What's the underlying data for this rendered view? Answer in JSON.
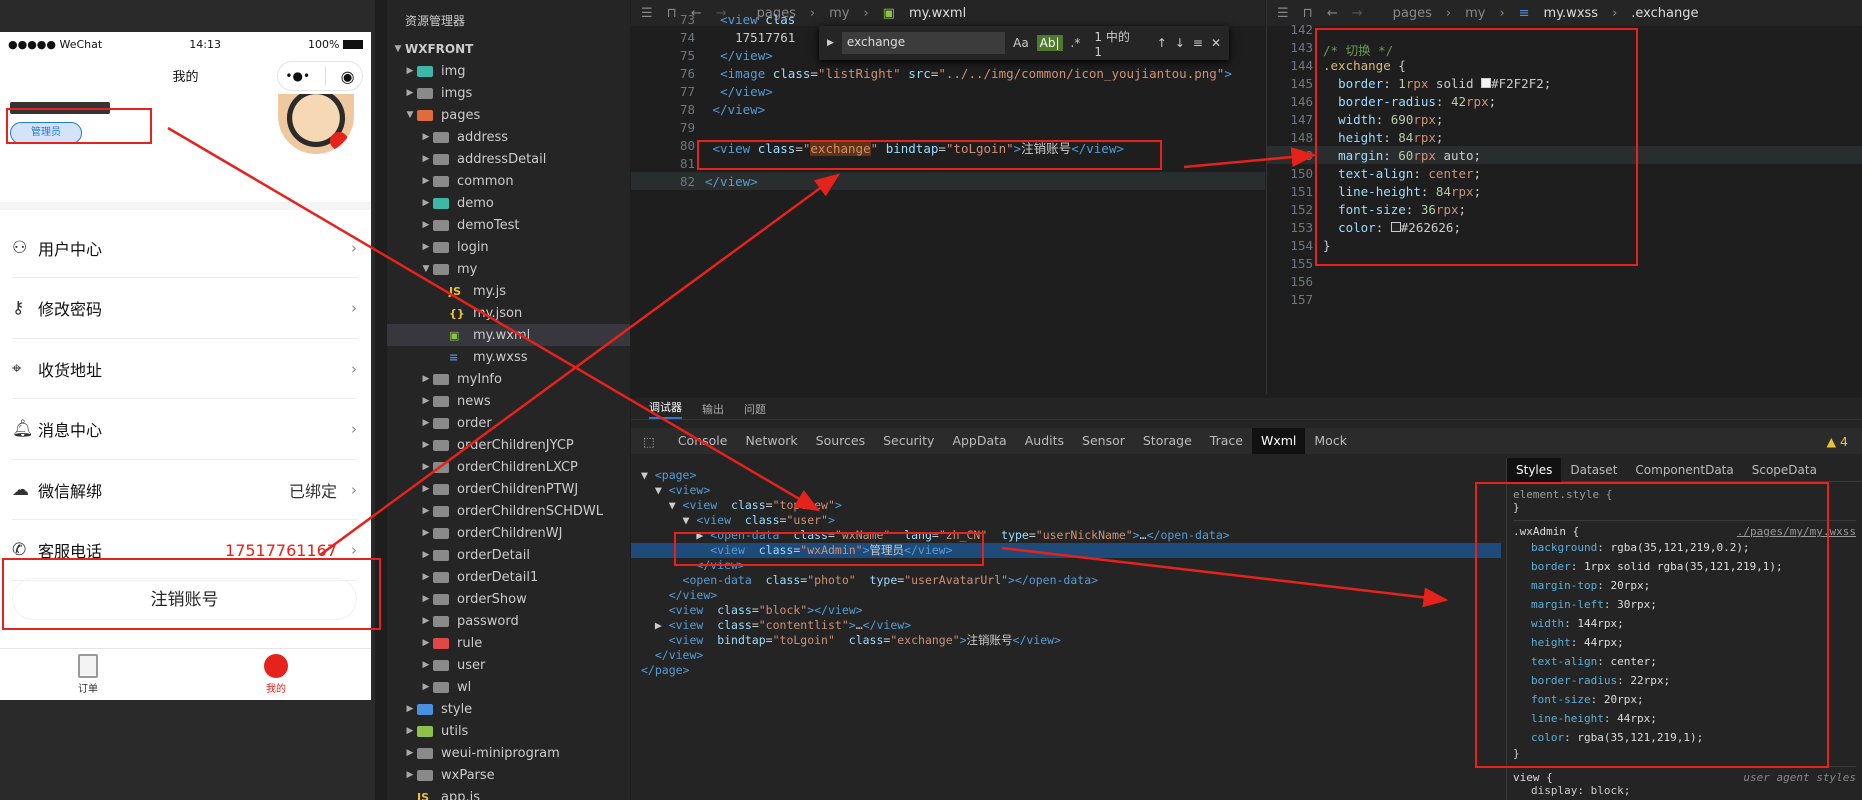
{
  "phone": {
    "status": {
      "carrier": "●●●●● WeChat",
      "time": "14:13",
      "battery": "100%"
    },
    "title": "我的",
    "capsule": {
      "more": "•●•",
      "close": "◉"
    },
    "admin_badge": "管理员",
    "menu": [
      {
        "icon": "user-icon",
        "label": "用户中心",
        "value": ""
      },
      {
        "icon": "key-icon",
        "label": "修改密码",
        "value": ""
      },
      {
        "icon": "location-pin-icon",
        "label": "收货地址",
        "value": ""
      },
      {
        "icon": "bell-icon",
        "label": "消息中心",
        "value": ""
      },
      {
        "icon": "wechat-icon",
        "label": "微信解绑",
        "value": "已绑定"
      },
      {
        "icon": "phone-icon",
        "label": "客服电话",
        "value": "17517761167"
      }
    ],
    "logout": "注销账号",
    "tabs": [
      {
        "label": "订单"
      },
      {
        "label": "我的"
      }
    ],
    "accent": "#e5221c"
  },
  "explorer": {
    "header": "资源管理器",
    "root": "WXFRONT",
    "items": [
      {
        "label": "img",
        "type": "folder",
        "color": "#3fb6a8",
        "exp": false
      },
      {
        "label": "imgs",
        "type": "folder",
        "color": "#8a8a8a",
        "exp": false
      },
      {
        "label": "pages",
        "type": "folder",
        "color": "#e06c3c",
        "exp": true
      },
      {
        "label": "address",
        "type": "folder",
        "color": "#8a8a8a",
        "exp": false
      },
      {
        "label": "addressDetail",
        "type": "folder",
        "color": "#8a8a8a",
        "exp": false
      },
      {
        "label": "common",
        "type": "folder",
        "color": "#8a8a8a",
        "exp": false
      },
      {
        "label": "demo",
        "type": "folder",
        "color": "#3fb6a8",
        "exp": false
      },
      {
        "label": "demoTest",
        "type": "folder",
        "color": "#8a8a8a",
        "exp": false
      },
      {
        "label": "login",
        "type": "folder",
        "color": "#8a8a8a",
        "exp": false
      },
      {
        "label": "my",
        "type": "folder",
        "color": "#8a8a8a",
        "exp": true
      },
      {
        "label": "my.js",
        "type": "js",
        "color": "#e8c23a",
        "exp": false
      },
      {
        "label": "my.json",
        "type": "json",
        "color": "#e8c23a",
        "exp": false
      },
      {
        "label": "my.wxml",
        "type": "wxml",
        "color": "#8bc34a",
        "exp": false
      },
      {
        "label": "my.wxss",
        "type": "wxss",
        "color": "#4a8fe0",
        "exp": false
      },
      {
        "label": "myInfo",
        "type": "folder",
        "color": "#8a8a8a",
        "exp": false
      },
      {
        "label": "news",
        "type": "folder",
        "color": "#8a8a8a",
        "exp": false
      },
      {
        "label": "order",
        "type": "folder",
        "color": "#8a8a8a",
        "exp": false
      },
      {
        "label": "orderChildrenJYCP",
        "type": "folder",
        "color": "#8a8a8a",
        "exp": false
      },
      {
        "label": "orderChildrenLXCP",
        "type": "folder",
        "color": "#8a8a8a",
        "exp": false
      },
      {
        "label": "orderChildrenPTWJ",
        "type": "folder",
        "color": "#8a8a8a",
        "exp": false
      },
      {
        "label": "orderChildrenSCHDWL",
        "type": "folder",
        "color": "#8a8a8a",
        "exp": false
      },
      {
        "label": "orderChildrenWJ",
        "type": "folder",
        "color": "#8a8a8a",
        "exp": false
      },
      {
        "label": "orderDetail",
        "type": "folder",
        "color": "#8a8a8a",
        "exp": false
      },
      {
        "label": "orderDetail1",
        "type": "folder",
        "color": "#8a8a8a",
        "exp": false
      },
      {
        "label": "orderShow",
        "type": "folder",
        "color": "#8a8a8a",
        "exp": false
      },
      {
        "label": "password",
        "type": "folder",
        "color": "#8a8a8a",
        "exp": false
      },
      {
        "label": "rule",
        "type": "folder",
        "color": "#e04848",
        "exp": false
      },
      {
        "label": "user",
        "type": "folder",
        "color": "#8a8a8a",
        "exp": false
      },
      {
        "label": "wl",
        "type": "folder",
        "color": "#8a8a8a",
        "exp": false
      },
      {
        "label": "style",
        "type": "folder",
        "color": "#4a8fe0",
        "exp": false
      },
      {
        "label": "utils",
        "type": "folder",
        "color": "#8bc34a",
        "exp": false
      },
      {
        "label": "weui-miniprogram",
        "type": "folder",
        "color": "#8a8a8a",
        "exp": false
      },
      {
        "label": "wxParse",
        "type": "folder",
        "color": "#8a8a8a",
        "exp": false
      },
      {
        "label": "app.js",
        "type": "js",
        "color": "#e8c23a",
        "exp": false
      }
    ]
  },
  "wxml_editor": {
    "breadcrumb": [
      "pages",
      "my",
      "my.wxml"
    ],
    "find": {
      "query": "exchange",
      "count": "1 中的 1"
    },
    "lines": [
      {
        "n": "73",
        "html": "  <span class='tag'>&lt;view</span> <span class='att'>clas</span>"
      },
      {
        "n": "74",
        "html": "    17517761"
      },
      {
        "n": "75",
        "html": "  <span class='tag'>&lt;/view&gt;</span>"
      },
      {
        "n": "76",
        "html": "  <span class='tag'>&lt;image</span> <span class='att'>class</span>=<span class='str'>\"listRight\"</span> <span class='att'>src</span>=<span class='str'>\"../../img/common/icon_youjiantou.png\"</span><span class='tag'>&gt;</span>"
      },
      {
        "n": "77",
        "html": "  <span class='tag'>&lt;/view&gt;</span>"
      },
      {
        "n": "78",
        "html": " <span class='tag'>&lt;/view&gt;</span>"
      },
      {
        "n": "79",
        "html": ""
      },
      {
        "n": "80",
        "html": " <span class='tag'>&lt;view</span> <span class='att'>class</span>=<span class='str'>\"<span style='background:#613214'>exchange</span>\"</span> <span class='att'>bindtap</span>=<span class='str'>\"toLgoin\"</span><span class='tag'>&gt;</span>注销账号<span class='tag'>&lt;/view&gt;</span>"
      },
      {
        "n": "81",
        "html": ""
      },
      {
        "n": "82",
        "html": "<span class='tag'>&lt;/view&gt;</span>"
      }
    ]
  },
  "wxss_editor": {
    "breadcrumb": [
      "pages",
      "my",
      "my.wxss",
      ".exchange"
    ],
    "lines": [
      {
        "n": "142",
        "html": ""
      },
      {
        "n": "143",
        "html": "<span class='cm'>/* 切换 */</span>"
      },
      {
        "n": "144",
        "html": "<span class='sel'>.exchange</span> {"
      },
      {
        "n": "145",
        "html": "  <span class='att'>border</span>: <span class='num'>1</span><span class='kw'>rpx</span> solid <span style='display:inline-block;width:10px;height:10px;background:#F2F2F2;border:1px solid #ccc'></span>#F2F2F2;"
      },
      {
        "n": "146",
        "html": "  <span class='att'>border-radius</span>: <span class='num'>42</span><span class='kw'>rpx</span>;"
      },
      {
        "n": "147",
        "html": "  <span class='att'>width</span>: <span class='num'>690</span><span class='kw'>rpx</span>;"
      },
      {
        "n": "148",
        "html": "  <span class='att'>height</span>: <span class='num'>84</span><span class='kw'>rpx</span>;"
      },
      {
        "n": "149",
        "html": "  <span class='att'>margin</span>: <span class='num'>60</span><span class='kw'>rpx</span> auto;"
      },
      {
        "n": "150",
        "html": "  <span class='att'>text-align</span>: <span class='kw'>center</span>;"
      },
      {
        "n": "151",
        "html": "  <span class='att'>line-height</span>: <span class='num'>84</span><span class='kw'>rpx</span>;"
      },
      {
        "n": "152",
        "html": "  <span class='att'>font-size</span>: <span class='num'>36</span><span class='kw'>rpx</span>;"
      },
      {
        "n": "153",
        "html": "  <span class='att'>color</span>: <span style='display:inline-block;width:10px;height:10px;background:#262626;border:1px solid #ccc'></span>#262626;"
      },
      {
        "n": "154",
        "html": "}"
      },
      {
        "n": "155",
        "html": ""
      },
      {
        "n": "156",
        "html": ""
      },
      {
        "n": "157",
        "html": ""
      }
    ]
  },
  "devtools": {
    "panel_tabs": [
      "调试器",
      "输出",
      "问题"
    ],
    "tabs": [
      "Console",
      "Network",
      "Sources",
      "Security",
      "AppData",
      "Audits",
      "Sensor",
      "Storage",
      "Trace",
      "Wxml",
      "Mock"
    ],
    "active_tab": "Wxml",
    "warn_count": "4",
    "tree": [
      {
        "html": "▼ <span class='tag'>&lt;page&gt;</span>"
      },
      {
        "html": "  ▼ <span class='tag'>&lt;view&gt;</span>"
      },
      {
        "html": "    ▼ <span class='tag'>&lt;view</span>  <span class='att'>class</span>=<span class='str'>\"topView\"</span><span class='tag'>&gt;</span>"
      },
      {
        "html": "      ▼ <span class='tag'>&lt;view</span>  <span class='att'>class</span>=<span class='str'>\"user\"</span><span class='tag'>&gt;</span>"
      },
      {
        "html": "        ▶ <span class='tag'>&lt;open-data</span>  <span class='att'>class</span>=<span class='str'>\"wxName\"</span>  <span class='att'>lang</span>=<span class='str'>\"zh_CN\"</span>  <span class='att'>type</span>=<span class='str'>\"userNickName\"</span><span class='tag'>&gt;</span>…<span class='tag'>&lt;/open-data&gt;</span>"
      },
      {
        "html": "          <span class='tag'>&lt;view</span>  <span class='att'>class</span>=<span class='str'>\"wxAdmin\"</span><span class='tag'>&gt;</span>管理员<span class='tag'>&lt;/view&gt;</span>",
        "hl": true
      },
      {
        "html": "        <span class='tag'>&lt;/view&gt;</span>"
      },
      {
        "html": "      <span class='tag'>&lt;open-data</span>  <span class='att'>class</span>=<span class='str'>\"photo\"</span>  <span class='att'>type</span>=<span class='str'>\"userAvatarUrl\"</span><span class='tag'>&gt;&lt;/open-data&gt;</span>"
      },
      {
        "html": "    <span class='tag'>&lt;/view&gt;</span>"
      },
      {
        "html": "    <span class='tag'>&lt;view</span>  <span class='att'>class</span>=<span class='str'>\"block\"</span><span class='tag'>&gt;&lt;/view&gt;</span>"
      },
      {
        "html": "  ▶ <span class='tag'>&lt;view</span>  <span class='att'>class</span>=<span class='str'>\"contentlist\"</span><span class='tag'>&gt;</span>…<span class='tag'>&lt;/view&gt;</span>"
      },
      {
        "html": "    <span class='tag'>&lt;view</span>  <span class='att'>bindtap</span>=<span class='str'>\"toLgoin\"</span>  <span class='att'>class</span>=<span class='str'>\"exchange\"</span><span class='tag'>&gt;</span>注销账号<span class='tag'>&lt;/view&gt;</span>"
      },
      {
        "html": "  <span class='tag'>&lt;/view&gt;</span>"
      },
      {
        "html": "<span class='tag'>&lt;/page&gt;</span>"
      }
    ],
    "style_tabs": [
      "Styles",
      "Dataset",
      "ComponentData",
      "ScopeData"
    ],
    "element_style": "element.style {",
    "rule_selector": ".wxAdmin {",
    "rule_source": "./pages/my/my.wxss",
    "props": [
      {
        "k": "background",
        "v": "rgba(35,121,219,0.2);"
      },
      {
        "k": "border",
        "v": "1rpx solid rgba(35,121,219,1);"
      },
      {
        "k": "margin-top",
        "v": "20rpx;"
      },
      {
        "k": "margin-left",
        "v": "30rpx;"
      },
      {
        "k": "width",
        "v": "144rpx;"
      },
      {
        "k": "height",
        "v": "44rpx;"
      },
      {
        "k": "text-align",
        "v": "center;"
      },
      {
        "k": "border-radius",
        "v": "22rpx;"
      },
      {
        "k": "font-size",
        "v": "20rpx;"
      },
      {
        "k": "line-height",
        "v": "44rpx;"
      },
      {
        "k": "color",
        "v": "rgba(35,121,219,1);"
      }
    ],
    "view_rule": "view {",
    "view_source": "user agent styles",
    "view_prop": "display: block;"
  }
}
